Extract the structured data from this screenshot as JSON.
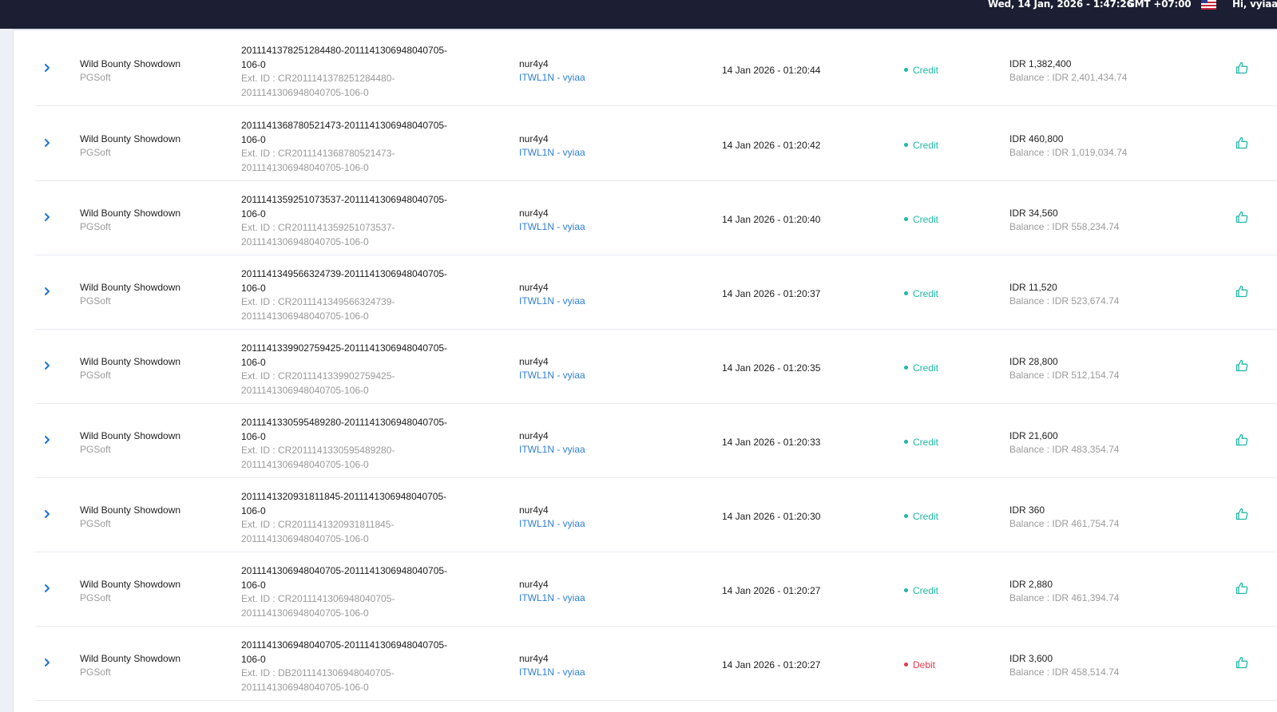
{
  "header": {
    "datetime": "Wed, 14 Jan, 2026 - 1:47:26",
    "timezone": "GMT +07:00",
    "greeting": "Hi, vyiaa",
    "flag_icon": "us-flag-icon"
  },
  "colors": {
    "topbar": "#1c1f33",
    "credit": "#1fb7a6",
    "debit": "#e2384b",
    "link": "#2f7fd3",
    "chevron": "#1e74d6"
  },
  "rows": [
    {
      "game": "Wild Bounty Showdown",
      "provider": "PGSoft",
      "id_line1": "2011141378251284480-2011141306948040705-",
      "id_line2": "106-0",
      "ext_line1": "Ext. ID : CR2011141378251284480-",
      "ext_line2": "2011141306948040705-106-0",
      "username": "nur4y4",
      "agent": "ITWL1N - vyiaa",
      "time": "14 Jan 2026 - 01:20:44",
      "type": "Credit",
      "amount": "IDR 1,382,400",
      "balance": "Balance : IDR 2,401,434.74"
    },
    {
      "game": "Wild Bounty Showdown",
      "provider": "PGSoft",
      "id_line1": "2011141368780521473-2011141306948040705-",
      "id_line2": "106-0",
      "ext_line1": "Ext. ID : CR2011141368780521473-",
      "ext_line2": "2011141306948040705-106-0",
      "username": "nur4y4",
      "agent": "ITWL1N - vyiaa",
      "time": "14 Jan 2026 - 01:20:42",
      "type": "Credit",
      "amount": "IDR 460,800",
      "balance": "Balance : IDR 1,019,034.74"
    },
    {
      "game": "Wild Bounty Showdown",
      "provider": "PGSoft",
      "id_line1": "2011141359251073537-2011141306948040705-",
      "id_line2": "106-0",
      "ext_line1": "Ext. ID : CR2011141359251073537-",
      "ext_line2": "2011141306948040705-106-0",
      "username": "nur4y4",
      "agent": "ITWL1N - vyiaa",
      "time": "14 Jan 2026 - 01:20:40",
      "type": "Credit",
      "amount": "IDR 34,560",
      "balance": "Balance : IDR 558,234.74"
    },
    {
      "game": "Wild Bounty Showdown",
      "provider": "PGSoft",
      "id_line1": "2011141349566324739-2011141306948040705-",
      "id_line2": "106-0",
      "ext_line1": "Ext. ID : CR2011141349566324739-",
      "ext_line2": "2011141306948040705-106-0",
      "username": "nur4y4",
      "agent": "ITWL1N - vyiaa",
      "time": "14 Jan 2026 - 01:20:37",
      "type": "Credit",
      "amount": "IDR 11,520",
      "balance": "Balance : IDR 523,674.74"
    },
    {
      "game": "Wild Bounty Showdown",
      "provider": "PGSoft",
      "id_line1": "2011141339902759425-2011141306948040705-",
      "id_line2": "106-0",
      "ext_line1": "Ext. ID : CR2011141339902759425-",
      "ext_line2": "2011141306948040705-106-0",
      "username": "nur4y4",
      "agent": "ITWL1N - vyiaa",
      "time": "14 Jan 2026 - 01:20:35",
      "type": "Credit",
      "amount": "IDR 28,800",
      "balance": "Balance : IDR 512,154.74"
    },
    {
      "game": "Wild Bounty Showdown",
      "provider": "PGSoft",
      "id_line1": "2011141330595489280-2011141306948040705-",
      "id_line2": "106-0",
      "ext_line1": "Ext. ID : CR2011141330595489280-",
      "ext_line2": "2011141306948040705-106-0",
      "username": "nur4y4",
      "agent": "ITWL1N - vyiaa",
      "time": "14 Jan 2026 - 01:20:33",
      "type": "Credit",
      "amount": "IDR 21,600",
      "balance": "Balance : IDR 483,354.74"
    },
    {
      "game": "Wild Bounty Showdown",
      "provider": "PGSoft",
      "id_line1": "2011141320931811845-2011141306948040705-",
      "id_line2": "106-0",
      "ext_line1": "Ext. ID : CR2011141320931811845-",
      "ext_line2": "2011141306948040705-106-0",
      "username": "nur4y4",
      "agent": "ITWL1N - vyiaa",
      "time": "14 Jan 2026 - 01:20:30",
      "type": "Credit",
      "amount": "IDR 360",
      "balance": "Balance : IDR 461,754.74"
    },
    {
      "game": "Wild Bounty Showdown",
      "provider": "PGSoft",
      "id_line1": "2011141306948040705-2011141306948040705-",
      "id_line2": "106-0",
      "ext_line1": "Ext. ID : CR2011141306948040705-",
      "ext_line2": "2011141306948040705-106-0",
      "username": "nur4y4",
      "agent": "ITWL1N - vyiaa",
      "time": "14 Jan 2026 - 01:20:27",
      "type": "Credit",
      "amount": "IDR 2,880",
      "balance": "Balance : IDR 461,394.74"
    },
    {
      "game": "Wild Bounty Showdown",
      "provider": "PGSoft",
      "id_line1": "2011141306948040705-2011141306948040705-",
      "id_line2": "106-0",
      "ext_line1": "Ext. ID : DB2011141306948040705-",
      "ext_line2": "2011141306948040705-106-0",
      "username": "nur4y4",
      "agent": "ITWL1N - vyiaa",
      "time": "14 Jan 2026 - 01:20:27",
      "type": "Debit",
      "amount": "IDR 3,600",
      "balance": "Balance : IDR 458,514.74"
    }
  ]
}
